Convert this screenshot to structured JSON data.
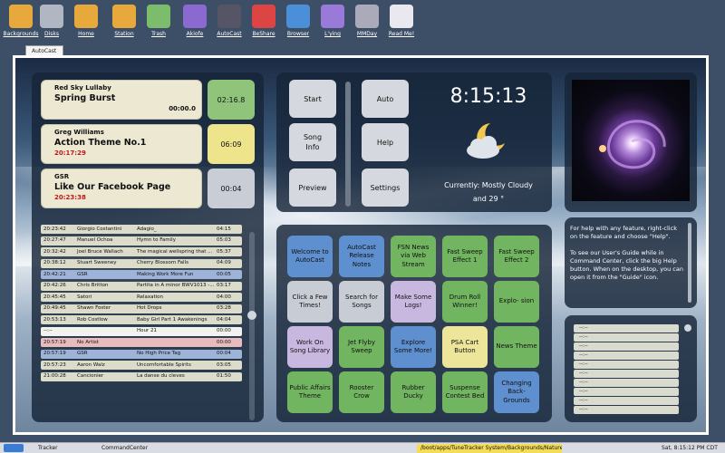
{
  "desktop": {
    "icons": [
      {
        "label": "Backgrounds",
        "icon": "folder-icon",
        "color": "#e8a93c"
      },
      {
        "label": "Disks",
        "icon": "disk-icon",
        "color": "#b0b6c2"
      },
      {
        "label": "Home",
        "icon": "home-folder-icon",
        "color": "#e8a93c"
      },
      {
        "label": "Station",
        "icon": "folder-icon",
        "color": "#e8a93c"
      },
      {
        "label": "Trash",
        "icon": "trash-icon",
        "color": "#7bbd6a"
      },
      {
        "label": "Akiofe",
        "icon": "pen-icon",
        "color": "#8a6ad0"
      },
      {
        "label": "AutoCast",
        "icon": "tower-icon",
        "color": "#556"
      },
      {
        "label": "BeShare",
        "icon": "beshare-icon",
        "color": "#d44"
      },
      {
        "label": "Browser",
        "icon": "globe-icon",
        "color": "#4a8fd8"
      },
      {
        "label": "L'ying",
        "icon": "magnifier-icon",
        "color": "#9a7ad8"
      },
      {
        "label": "MMDay",
        "icon": "book-icon",
        "color": "#aab"
      },
      {
        "label": "Read Me!",
        "icon": "document-icon",
        "color": "#e8e8ee"
      }
    ]
  },
  "window": {
    "tab": "AutoCast"
  },
  "carts": [
    {
      "artist": "Red Sky Lullaby",
      "title": "Spring Burst",
      "remain": "00:00.0",
      "remain_style": "blk",
      "time": "02:16.8",
      "color": "#8fc47a"
    },
    {
      "artist": "Greg Williams",
      "title": "Action Theme No.1",
      "remain": "20:17:29",
      "remain_style": "red",
      "time": "06:09",
      "color": "#ede48c"
    },
    {
      "artist": "GSR",
      "title": "Like Our Facebook Page",
      "remain": "20:23:38",
      "remain_style": "red",
      "time": "00:04",
      "color": "#c9cdd6"
    }
  ],
  "playlist": [
    {
      "time": "20:23:42",
      "artist": "Giorgio Costantini",
      "title": "Adagio_",
      "len": "04:15",
      "color": "#dcdccb"
    },
    {
      "time": "20:27:47",
      "artist": "Manuel Ochoa",
      "title": "Hymn to Family",
      "len": "05:03",
      "color": "#dcdccb"
    },
    {
      "time": "20:32:42",
      "artist": "Joel Bruce Wallach",
      "title": "The magical wellspring that ...",
      "len": "05:37",
      "color": "#dcdccb"
    },
    {
      "time": "20:38:12",
      "artist": "Stuart Sweeney",
      "title": "Cherry Blossom Falls",
      "len": "04:09",
      "color": "#dcdccb"
    },
    {
      "time": "20:42:21",
      "artist": "GSR",
      "title": "Making Work More Fun",
      "len": "00:05",
      "color": "#9db4d8"
    },
    {
      "time": "20:42:26",
      "artist": "Chris Britton",
      "title": "Partita in A minor BWV1013 -...",
      "len": "03:17",
      "color": "#dcdccb"
    },
    {
      "time": "20:45:45",
      "artist": "Satori",
      "title": "Relaxation",
      "len": "04:00",
      "color": "#dcdccb"
    },
    {
      "time": "20:49:45",
      "artist": "Shawn Foster",
      "title": "Hot Drops",
      "len": "03:28",
      "color": "#dcdccb"
    },
    {
      "time": "20:53:13",
      "artist": "Rob Costlow",
      "title": "Baby Girl Part 1 Awakenings",
      "len": "04:04",
      "color": "#dcdccb"
    },
    {
      "time": "--:--",
      "artist": "",
      "title": "Hour 21",
      "len": "00:00",
      "color": "#f2f2ee"
    },
    {
      "time": "20:57:19",
      "artist": "No Artist",
      "title": "",
      "len": "00:00",
      "color": "#e8bcbc"
    },
    {
      "time": "20:57:19",
      "artist": "GSR",
      "title": "No High Price Tag",
      "len": "00:04",
      "color": "#9db4d8"
    },
    {
      "time": "20:57:23",
      "artist": "Aaron Walz",
      "title": "Uncomfortable Spirits",
      "len": "03:05",
      "color": "#dcdccb"
    },
    {
      "time": "21:00:28",
      "artist": "Cancionier",
      "title": "La danse du cleves",
      "len": "01:50",
      "color": "#dcdccb"
    }
  ],
  "controls": {
    "start": "Start",
    "auto": "Auto",
    "song_info": "Song\nInfo",
    "help": "Help",
    "preview": "Preview",
    "settings": "Settings"
  },
  "clock": {
    "time": "8:15:13",
    "weather": "Currently: Mostly Cloudy",
    "temp": "and 29 °"
  },
  "cartwall": [
    {
      "label": "Welcome to AutoCast",
      "color": "blue"
    },
    {
      "label": "AutoCast Release Notes",
      "color": "blue"
    },
    {
      "label": "FSN News via Web Stream",
      "color": "green"
    },
    {
      "label": "Fast Sweep Effect 1",
      "color": "green"
    },
    {
      "label": "Fast Sweep Effect 2",
      "color": "green"
    },
    {
      "label": "Click a Few Times!",
      "color": "grey"
    },
    {
      "label": "Search for Songs",
      "color": "grey"
    },
    {
      "label": "Make Some Logs!",
      "color": "lav"
    },
    {
      "label": "Drum Roll Winner!",
      "color": "green"
    },
    {
      "label": "Explo- sion",
      "color": "green"
    },
    {
      "label": "Work On Song Library",
      "color": "lav"
    },
    {
      "label": "Jet Flyby Sweep",
      "color": "green"
    },
    {
      "label": "Explore Some More!",
      "color": "blue"
    },
    {
      "label": "PSA Cart Button",
      "color": "yel"
    },
    {
      "label": "News Theme",
      "color": "green"
    },
    {
      "label": "Public Affairs Theme",
      "color": "green"
    },
    {
      "label": "Rooster Crow",
      "color": "green"
    },
    {
      "label": "Rubber Ducky",
      "color": "green"
    },
    {
      "label": "Suspense Contest Bed",
      "color": "green"
    },
    {
      "label": "Changing Back- Grounds",
      "color": "blue"
    }
  ],
  "help_text": "For help with any feature, right-click on the feature and choose \"Help\".\n\nTo see our User's Guide while in Command Center, click the big Help button. When on the desktop, you can open it from the \"Guide\" icon.",
  "side_lines": [
    "--:--",
    "--:--",
    "--:--",
    "--:--",
    "--:--",
    "--:--",
    "--:--",
    "--:--",
    "--:--",
    "--:--"
  ],
  "taskbar": {
    "tracker": "Tracker",
    "command_center": "CommandCenter",
    "path": "/boot/apps/TuneTracker System/Backgrounds/Nature",
    "datetime": "Sat, 8:15:12 PM CDT"
  }
}
